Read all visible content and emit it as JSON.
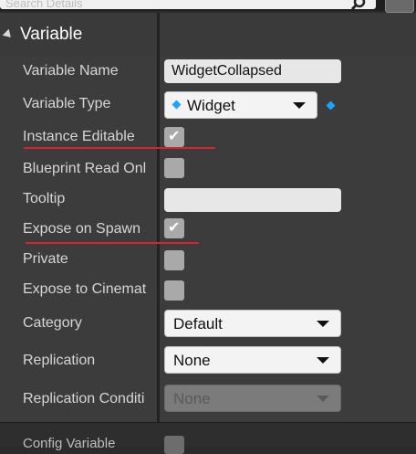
{
  "search": {
    "placeholder": "Search Details"
  },
  "section": {
    "title": "Variable"
  },
  "properties": {
    "variable_name": {
      "label": "Variable Name",
      "value": "WidgetCollapsed"
    },
    "variable_type": {
      "label": "Variable Type",
      "value": "Widget"
    },
    "instance_editable": {
      "label": "Instance Editable",
      "checked": true
    },
    "blueprint_read_only": {
      "label": "Blueprint Read Onl",
      "checked": false
    },
    "tooltip": {
      "label": "Tooltip",
      "value": ""
    },
    "expose_on_spawn": {
      "label": "Expose on Spawn",
      "checked": true
    },
    "private": {
      "label": "Private",
      "checked": false
    },
    "expose_to_cinematics": {
      "label": "Expose to Cinemat",
      "checked": false
    },
    "category": {
      "label": "Category",
      "value": "Default"
    },
    "replication": {
      "label": "Replication",
      "value": "None"
    },
    "replication_condition": {
      "label": "Replication Conditi",
      "value": "None"
    }
  },
  "bottom": {
    "label": "Config Variable"
  },
  "colors": {
    "accent_pin": "#1aa3ff",
    "annotation_underline": "#d7242d"
  },
  "glyphs": {
    "check": "✔"
  }
}
